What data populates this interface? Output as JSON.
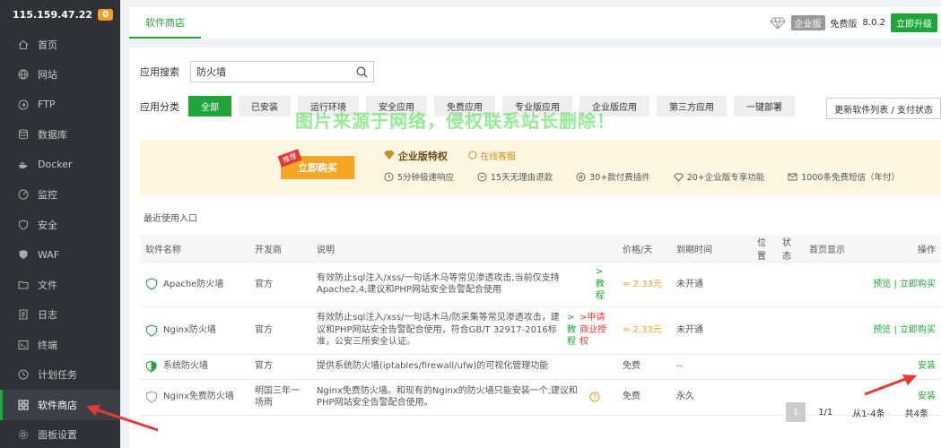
{
  "sidebar": {
    "ip": "115.159.47.22",
    "badge": "0",
    "items": [
      {
        "label": "首页",
        "icon": "home-icon"
      },
      {
        "label": "网站",
        "icon": "globe-icon"
      },
      {
        "label": "FTP",
        "icon": "ftp-icon"
      },
      {
        "label": "数据库",
        "icon": "database-icon"
      },
      {
        "label": "Docker",
        "icon": "docker-icon"
      },
      {
        "label": "监控",
        "icon": "monitor-icon"
      },
      {
        "label": "安全",
        "icon": "shield-icon"
      },
      {
        "label": "WAF",
        "icon": "waf-icon"
      },
      {
        "label": "文件",
        "icon": "folder-icon"
      },
      {
        "label": "日志",
        "icon": "log-icon"
      },
      {
        "label": "终端",
        "icon": "terminal-icon"
      },
      {
        "label": "计划任务",
        "icon": "clock-icon"
      },
      {
        "label": "软件商店",
        "icon": "grid-icon"
      },
      {
        "label": "面板设置",
        "icon": "gear-icon"
      }
    ]
  },
  "topbar": {
    "tab": "软件商店",
    "edition": "企业版",
    "free": "免费版",
    "version": "8.0.2",
    "upgrade": "立即升级"
  },
  "search": {
    "label": "应用搜索",
    "value": "防火墙"
  },
  "categories": {
    "label": "应用分类",
    "items": [
      "全部",
      "已安装",
      "运行环境",
      "安全应用",
      "免费应用",
      "专业版应用",
      "企业版应用",
      "第三方应用",
      "一键部署"
    ],
    "update_button": "更新软件列表 / 支付状态"
  },
  "watermark": "图片来源于网络，侵权联系站长删除！",
  "banner": {
    "tag": "推荐",
    "buy": "立即购买",
    "title": "企业版特权",
    "service": "在线客服",
    "perks": [
      "5分钟极速响应",
      "15天无理由退款",
      "30+款付费插件",
      "20+企业版专享功能",
      "1000条免费短信（年付）"
    ]
  },
  "recent_label": "最近使用入口",
  "table": {
    "headers": [
      "软件名称",
      "开发商",
      "说明",
      "价格/天",
      "到期时间",
      "位置",
      "状态",
      "首页显示",
      "操作"
    ],
    "rows": [
      {
        "name": "Apache防火墙",
        "dev": "官方",
        "desc": "有效防止sql注入/xss/一句话木马等常见渗透攻击,当前仅支持Apache2.4,建议和PHP网站安全告警配合使用",
        "link1": ">教程",
        "link2": "",
        "price": "≈ 2.33元",
        "expire": "未开通",
        "op1": "预览",
        "op2": "立即购买"
      },
      {
        "name": "Nginx防火墙",
        "dev": "官方",
        "desc": "有效防止sql注入/xss/一句话木马/防采集等常见渗透攻击，建议和PHP网站安全告警配合使用，符合GB/T 32917-2016标准，公安三所安全认证。",
        "link1": ">教程",
        "link2": ">申请商业授权",
        "price": "≈ 2.33元",
        "expire": "未开通",
        "op1": "预览",
        "op2": "立即购买"
      },
      {
        "name": "系统防火墙",
        "dev": "官方",
        "desc": "提供系统防火墙(iptables/firewall/ufw)的可视化管理功能",
        "link1": "",
        "link2": "",
        "price": "免费",
        "expire": "--",
        "op1": "安装",
        "op2": ""
      },
      {
        "name": "Nginx免费防火墙",
        "dev": "明国三年一场雨",
        "desc": "Nginx免费防火墙。和现有的Nginx的防火墙只能安装一个,建议和PHP网站安全告警配合使用。",
        "link1": "",
        "link2": "",
        "price": "免费",
        "expire": "永久",
        "op1": "安装",
        "op2": ""
      }
    ]
  },
  "pager": {
    "current": "1",
    "pages": "1/1",
    "range": "从1-4条",
    "total": "共4条"
  },
  "colors": {
    "accent": "#20a53a",
    "sidebar_bg": "#2f3136",
    "price": "#f0a020",
    "arrow": "#e53935"
  }
}
